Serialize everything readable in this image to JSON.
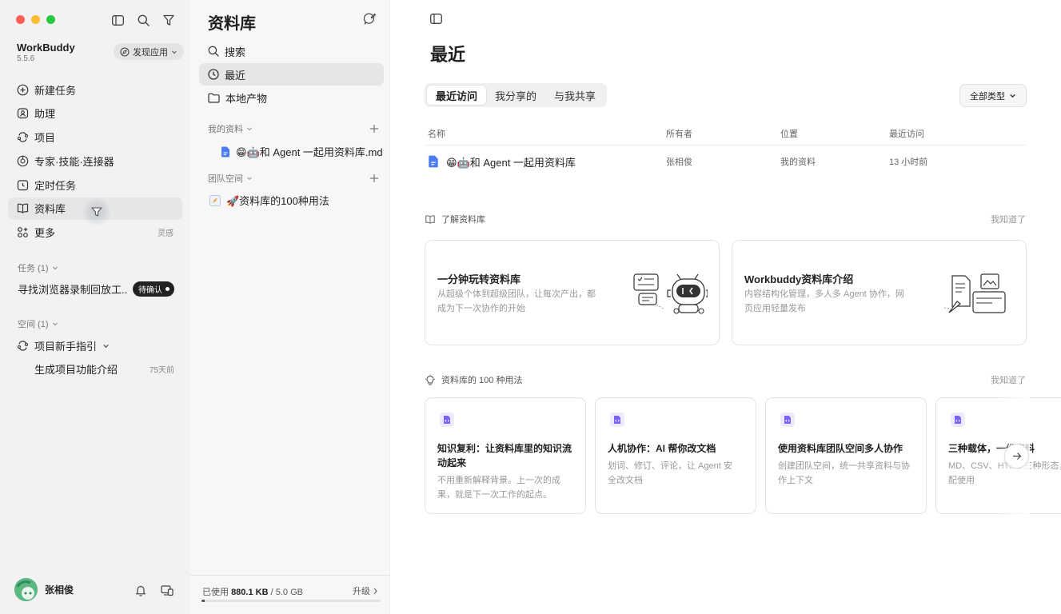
{
  "app": {
    "name": "WorkBuddy",
    "version": "5.5.6",
    "discover_label": "发现应用"
  },
  "sidebar": {
    "nav": [
      {
        "label": "新建任务",
        "icon": "plus-circle-icon"
      },
      {
        "label": "助理",
        "icon": "assistant-icon"
      },
      {
        "label": "项目",
        "icon": "project-icon"
      },
      {
        "label": "专家·技能·连接器",
        "icon": "expert-icon"
      },
      {
        "label": "定时任务",
        "icon": "alarm-clock-icon"
      },
      {
        "label": "资料库",
        "icon": "book-icon"
      },
      {
        "label": "更多",
        "icon": "grid-icon",
        "hint": "灵感"
      }
    ],
    "tasks_label": "任务 (1)",
    "task": {
      "title": "寻找浏览器录制回放工...",
      "status": "待确认"
    },
    "spaces_label": "空间 (1)",
    "space": {
      "name": "项目新手指引",
      "child": "生成项目功能介绍",
      "child_time": "75天前"
    },
    "user": {
      "name": "张相俊"
    }
  },
  "library": {
    "title": "资料库",
    "nav": [
      {
        "label": "搜索",
        "icon": "search-icon"
      },
      {
        "label": "最近",
        "icon": "clock-icon"
      },
      {
        "label": "本地产物",
        "icon": "folder-icon"
      }
    ],
    "my_section": "我的资料",
    "my_file": "😁🤖和 Agent 一起用资料库.md",
    "team_section": "团队空间",
    "team_file": "🚀资料库的100种用法",
    "storage": {
      "used_label": "已使用",
      "used": "880.1 KB",
      "separator": "/",
      "total": "5.0 GB",
      "upgrade": "升级",
      "fraction": 0.017
    }
  },
  "main": {
    "title": "最近",
    "tabs": [
      "最近访问",
      "我分享的",
      "与我共享"
    ],
    "filter_label": "全部类型",
    "columns": [
      "名称",
      "所有者",
      "位置",
      "最近访问"
    ],
    "rows": [
      {
        "name": "😁🤖和 Agent 一起用资料库",
        "owner": "张相俊",
        "location": "我的资料",
        "time": "13 小时前"
      }
    ],
    "learn_section": {
      "title": "了解资料库",
      "dismiss": "我知道了"
    },
    "learn_cards": [
      {
        "title": "一分钟玩转资料库",
        "desc": "从超级个体到超级团队，让每次产出，都成为下一次协作的开始"
      },
      {
        "title": "Workbuddy资料库介绍",
        "desc": "内容结构化管理，多人多 Agent 协作，网页应用轻量发布"
      }
    ],
    "uses_section": {
      "title": "资料库的 100 种用法",
      "dismiss": "我知道了"
    },
    "use_cards": [
      {
        "title": "知识复利：让资料库里的知识流动起来",
        "desc": "不用重新解释背景。上一次的成果，就是下一次工作的起点。"
      },
      {
        "title": "人机协作：AI 帮你改文档",
        "desc": "划词、修订、评论，让 Agent 安全改文档"
      },
      {
        "title": "使用资料库团队空间多人协作",
        "desc": "创建团队空间，统一共享资料与协作上下文"
      },
      {
        "title": "三种载体，一份资料",
        "desc": "MD、CSV、HTML 三种形态，搭配使用"
      }
    ]
  }
}
